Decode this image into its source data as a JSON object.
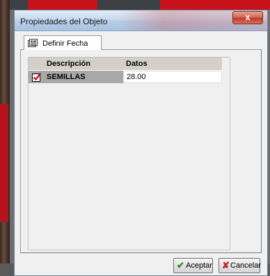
{
  "window": {
    "title": "Propiedades del Objeto",
    "close_symbol": "x"
  },
  "tabs": [
    {
      "label": "Definir Fecha",
      "icon": "form-icon"
    }
  ],
  "grid": {
    "columns": [
      "Descripción",
      "Datos"
    ],
    "rows": [
      {
        "checked": true,
        "description": "SEMILLAS",
        "value": "28.00"
      }
    ]
  },
  "buttons": {
    "accept": {
      "label": "Aceptar",
      "icon": "check-icon",
      "symbol": "✔"
    },
    "cancel": {
      "label": "Cancelar",
      "icon": "x-icon",
      "symbol": "✘"
    }
  },
  "colors": {
    "accept_icon": "#2f8a1f",
    "cancel_icon": "#c42020",
    "checkbox_mark": "#c0141c"
  }
}
